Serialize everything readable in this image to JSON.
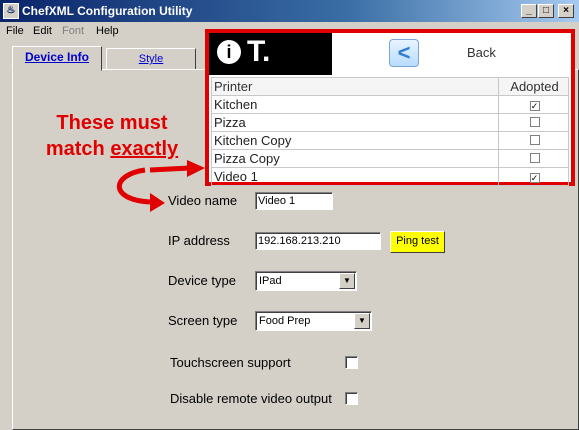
{
  "window": {
    "title": "ChefXML Configuration Utility",
    "app_icon": "chef-icon",
    "minimize": "_",
    "maximize": "□",
    "close": "×"
  },
  "menu": [
    "File",
    "Edit",
    "Font",
    "Help"
  ],
  "tabs": [
    "Device Info",
    "Style"
  ],
  "overlay": {
    "back_label": "Back",
    "back_icon": "<",
    "logo_glyph1": "i",
    "logo_glyph2": "T.",
    "columns": [
      "Printer",
      "Adopted"
    ],
    "rows": [
      {
        "printer": "Kitchen",
        "adopted": true
      },
      {
        "printer": "Pizza",
        "adopted": false
      },
      {
        "printer": "Kitchen Copy",
        "adopted": false
      },
      {
        "printer": "Pizza Copy",
        "adopted": false
      },
      {
        "printer": "Video 1",
        "adopted": true
      }
    ]
  },
  "annotation": {
    "line1": "These must",
    "line2": "match",
    "line2_emph": "exactly",
    "color": "#e00000"
  },
  "form": {
    "video_name_label": "Video name",
    "video_name_value": "Video 1",
    "ip_label": "IP address",
    "ip_value": "192.168.213.210",
    "ping_label": "Ping test",
    "device_type_label": "Device type",
    "device_type_value": "IPad",
    "screen_type_label": "Screen type",
    "screen_type_value": "Food Prep",
    "touchscreen_label": "Touchscreen support",
    "touchscreen_checked": false,
    "disable_remote_label": "Disable remote video output",
    "disable_remote_checked": false
  }
}
